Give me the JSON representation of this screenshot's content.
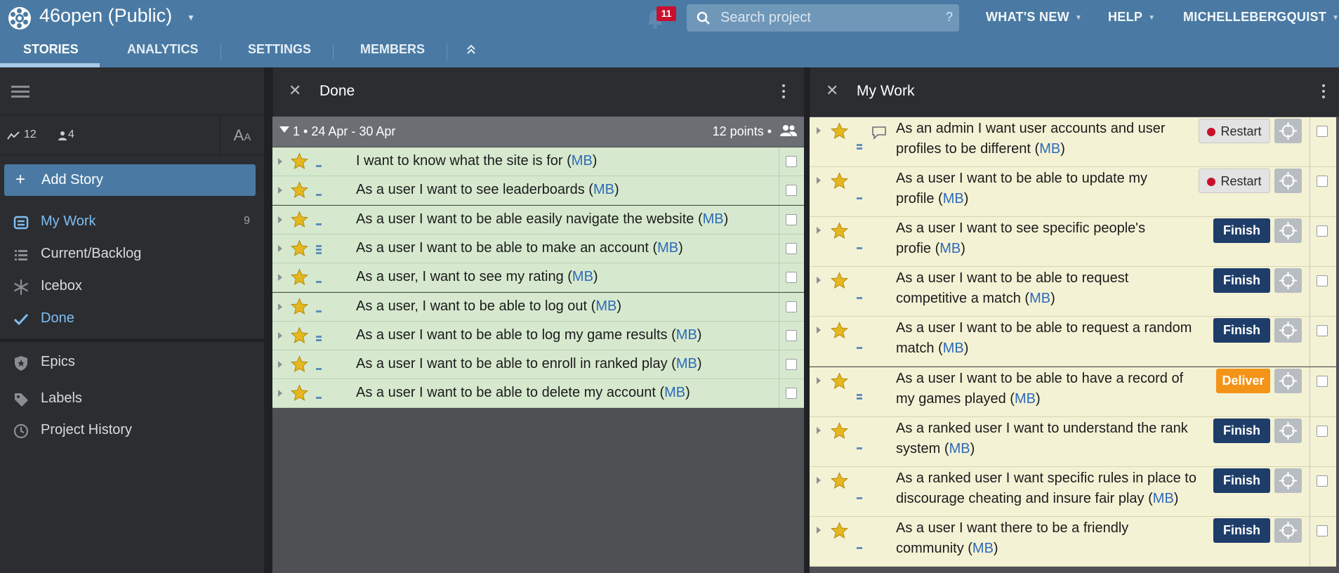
{
  "header": {
    "project_title": "46open  (Public)",
    "notification_count": "11",
    "search_placeholder": "Search project",
    "search_help": "?",
    "nav": {
      "whats_new": "WHAT'S NEW",
      "help": "HELP",
      "user": "MICHELLEBERGQUIST"
    },
    "tabs": [
      "STORIES",
      "ANALYTICS",
      "SETTINGS",
      "MEMBERS"
    ]
  },
  "sidebar": {
    "stats": {
      "velocity": "12",
      "members": "4"
    },
    "font_toggle": "AA",
    "add_story": "Add Story",
    "items": [
      {
        "label": "My Work",
        "count": "9",
        "icon": "my-work-icon"
      },
      {
        "label": "Current/Backlog",
        "icon": "list-icon"
      },
      {
        "label": "Icebox",
        "icon": "snowflake-icon"
      },
      {
        "label": "Done",
        "icon": "checkmark-icon"
      },
      {
        "label": "Epics",
        "icon": "shield-star-icon"
      },
      {
        "label": "Labels",
        "icon": "tag-icon"
      },
      {
        "label": "Project History",
        "icon": "clock-icon"
      }
    ]
  },
  "done_panel": {
    "title": "Done",
    "iteration": {
      "label": "1 • 24 Apr - 30 Apr",
      "points": "12 points •"
    },
    "stories": [
      {
        "text": "I want to know what the site is for (",
        "owner": "MB",
        "estimate": 1
      },
      {
        "text": "As a user I want to see leaderboards (",
        "owner": "MB",
        "estimate": 1
      },
      {
        "text": "As a user I want to be able easily navigate the website (",
        "owner": "MB",
        "estimate": 1
      },
      {
        "text": "As a user I want to be able to make an account (",
        "owner": "MB",
        "estimate": 3
      },
      {
        "text": "As a user, I want to see my rating (",
        "owner": "MB",
        "estimate": 1
      },
      {
        "text": "As a user, I want to be able to log out (",
        "owner": "MB",
        "estimate": 1
      },
      {
        "text": "As a user I want to be able to log my game results (",
        "owner": "MB",
        "estimate": 2
      },
      {
        "text": "As a user I want to be able to enroll in ranked play (",
        "owner": "MB",
        "estimate": 1
      },
      {
        "text": "As a user I want to be able to delete my account (",
        "owner": "MB",
        "estimate": 1
      }
    ]
  },
  "mywork_panel": {
    "title": "My Work",
    "stories": [
      {
        "line1": "As an admin I want user accounts and user",
        "line2": "profiles to be different (",
        "owner": "MB",
        "button": "Restart",
        "button_type": "restart",
        "estimate": 2,
        "comment": true
      },
      {
        "line1": "As a user I want to be able to update my",
        "line2": "profile (",
        "owner": "MB",
        "button": "Restart",
        "button_type": "restart",
        "estimate": 1
      },
      {
        "line1": "As a user I want to see specific people's",
        "line2": "profie (",
        "owner": "MB",
        "button": "Finish",
        "button_type": "finish",
        "estimate": 1
      },
      {
        "line1": "As a user I want to be able to request",
        "line2": "competitive a match (",
        "owner": "MB",
        "button": "Finish",
        "button_type": "finish",
        "estimate": 1
      },
      {
        "line1": "As a user I want to be able to request a random",
        "line2": "match (",
        "owner": "MB",
        "button": "Finish",
        "button_type": "finish",
        "estimate": 1
      },
      {
        "line1": "As a user I want to be able to have a record of",
        "line2": "my games played (",
        "owner": "MB",
        "button": "Deliver",
        "button_type": "deliver",
        "estimate": 2
      },
      {
        "line1": "As a ranked user I want to understand the rank",
        "line2": "system (",
        "owner": "MB",
        "button": "Finish",
        "button_type": "finish",
        "estimate": 1
      },
      {
        "line1": "As a ranked user I want specific rules in place to",
        "line2": "discourage cheating and insure fair play (",
        "owner": "MB",
        "button": "Finish",
        "button_type": "finish",
        "estimate": 1
      },
      {
        "line1": "As a user I want there to be a friendly",
        "line2": "community (",
        "owner": "MB",
        "button": "Finish",
        "button_type": "finish",
        "estimate": 1
      }
    ]
  },
  "colors": {
    "header": "#4a7aa3",
    "done_row": "#d6e9cf",
    "work_row": "#f4f2d5",
    "finish": "#1e3d69",
    "deliver": "#f39418",
    "restart_dot": "#c8102e",
    "owner_link": "#2d6ab8"
  }
}
